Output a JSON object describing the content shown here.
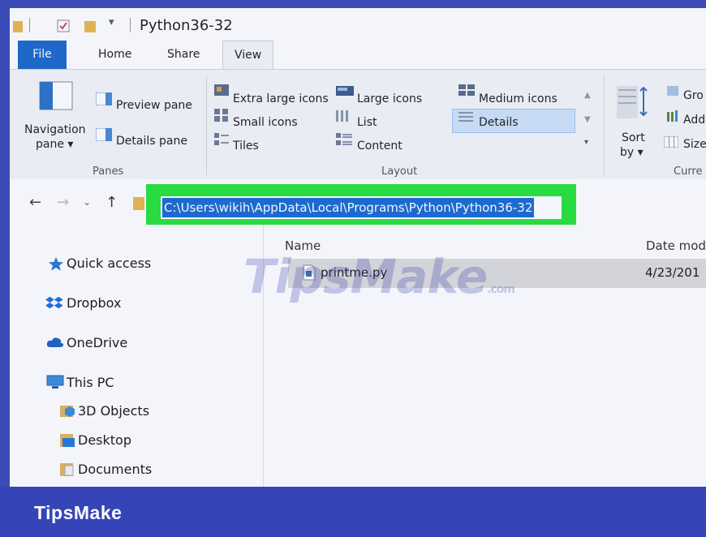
{
  "title_bar": {
    "title": "Python36-32"
  },
  "ribbon_tabs": [
    {
      "label": "File"
    },
    {
      "label": "Home"
    },
    {
      "label": "Share"
    },
    {
      "label": "View"
    }
  ],
  "ribbon": {
    "panes": {
      "navigation_pane_line1": "Navigation",
      "navigation_pane_line2": "pane ▾",
      "preview_pane": "Preview pane",
      "details_pane": "Details pane",
      "group_label": "Panes"
    },
    "layout": {
      "extra_large_icons": "Extra large icons",
      "large_icons": "Large icons",
      "medium_icons": "Medium icons",
      "small_icons": "Small icons",
      "list": "List",
      "details": "Details",
      "tiles": "Tiles",
      "content": "Content",
      "group_label": "Layout"
    },
    "current_view": {
      "sort_by_line1": "Sort",
      "sort_by_line2": "by ▾",
      "group_by": "Gro",
      "add_columns": "Add",
      "size_columns": "Size",
      "group_label": "Curre"
    }
  },
  "address_bar": {
    "path": "C:\\Users\\wikih\\AppData\\Local\\Programs\\Python\\Python36-32",
    "highlight_color": "#27e43a"
  },
  "nav_pane": {
    "items": [
      {
        "label": "Quick access",
        "icon": "star-icon"
      },
      {
        "label": "Dropbox",
        "icon": "dropbox-icon"
      },
      {
        "label": "OneDrive",
        "icon": "cloud-icon"
      },
      {
        "label": "This PC",
        "icon": "computer-icon"
      },
      {
        "label": "3D Objects",
        "icon": "cube-folder-icon"
      },
      {
        "label": "Desktop",
        "icon": "desktop-folder-icon"
      },
      {
        "label": "Documents",
        "icon": "documents-folder-icon"
      }
    ]
  },
  "file_list": {
    "columns": [
      "Name",
      "Date mod"
    ],
    "rows": [
      {
        "name": "printme.py",
        "date": "4/23/201"
      }
    ]
  },
  "watermark": {
    "text": "TipsMake",
    "suffix": ".com"
  },
  "banner": {
    "brand": "TipsMake"
  },
  "colors": {
    "accent": "#1a6cd1",
    "banner": "#3545b8",
    "file_tab": "#1b6ac9"
  }
}
